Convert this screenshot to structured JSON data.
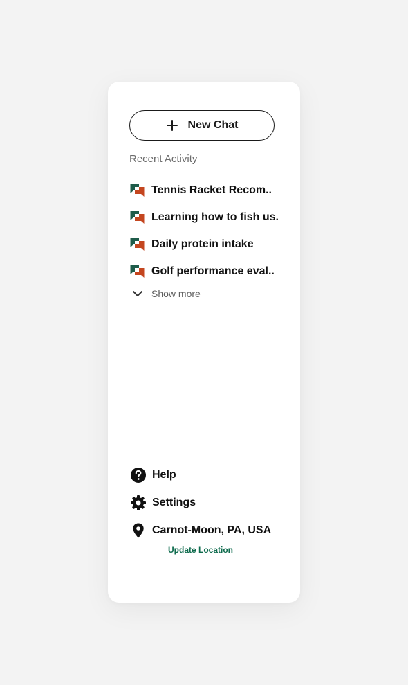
{
  "new_chat": {
    "label": "New Chat",
    "icon": "plus-icon"
  },
  "recent_activity": {
    "title": "Recent Activity",
    "items": [
      {
        "label": "Tennis Racket Recom..",
        "icon": "chat-bubbles-icon"
      },
      {
        "label": "Learning how to fish us..",
        "icon": "chat-bubbles-icon"
      },
      {
        "label": "Daily protein intake",
        "icon": "chat-bubbles-icon"
      },
      {
        "label": "Golf performance eval..",
        "icon": "chat-bubbles-icon"
      }
    ],
    "show_more": {
      "label": "Show more",
      "icon": "chevron-down-icon"
    }
  },
  "footer": {
    "help": {
      "label": "Help",
      "icon": "help-circle-icon"
    },
    "settings": {
      "label": "Settings",
      "icon": "gear-icon"
    },
    "location": {
      "label": "Carnot-Moon, PA, USA",
      "icon": "map-pin-icon"
    },
    "update_location": {
      "label": "Update Location"
    }
  },
  "colors": {
    "accent_green": "#1f5c4a",
    "accent_orange": "#c4461f",
    "link_green": "#0e6b4d",
    "page_bg": "#f3f3f3",
    "panel_bg": "#ffffff"
  }
}
